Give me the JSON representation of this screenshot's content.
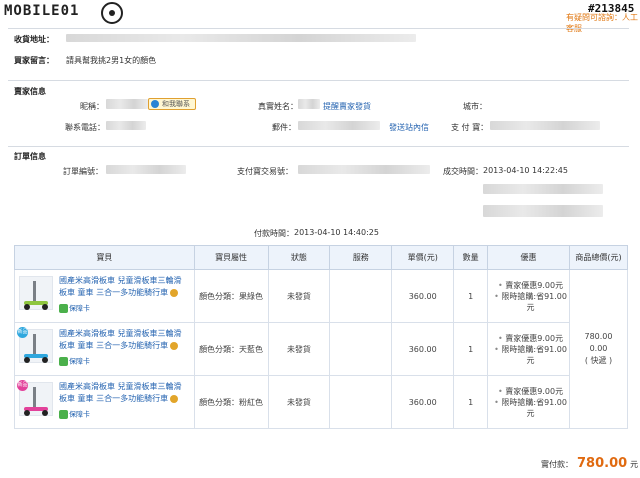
{
  "header": {
    "logo": "MOBILE01",
    "watermark": "#213845",
    "top_link_prefix": "有疑問可諮詢：",
    "top_link_text": "人工客服"
  },
  "shipping": {
    "address_label": "收貨地址：",
    "message_label": "買家留言：",
    "message_value": "請具幫我挑2男1女的顏色"
  },
  "seller": {
    "heading": "賣家信息",
    "nickname_label": "昵稱：",
    "contact_tag": "和我聯系",
    "realname_label": "真實姓名：",
    "realname_link": "提醒賣家發貨",
    "city_label": "城市：",
    "phone_label": "聯系電話：",
    "email_label": "郵件：",
    "send_msg_link": "發送站內信",
    "alipay_label": "支 付 寶："
  },
  "order": {
    "heading": "訂單信息",
    "order_no_label": "訂單編號：",
    "trade_no_label": "支付寶交易號：",
    "deal_time_label": "成交時間：",
    "deal_time_value": "2013-04-10 14:22:45",
    "pay_time_label": "付款時間：",
    "pay_time_value": "2013-04-10 14:40:25"
  },
  "table": {
    "headers": [
      "寶貝",
      "寶貝屬性",
      "狀態",
      "服務",
      "單價(元)",
      "數量",
      "優惠",
      "商品總價(元)"
    ],
    "rows": [
      {
        "title": "國產米高滑板車 兒童滑板車三輪滑板車 童車 三合一多功能騎行車",
        "guard": "保障卡",
        "attr": "顏色分類：果綠色",
        "status": "未發貨",
        "price": "360.00",
        "qty": "1",
        "promo1": "賣家優惠9.00元",
        "promo2": "限時搶購:省91.00元",
        "color": "#8ec63f",
        "badge": ""
      },
      {
        "title": "國產米高滑板車 兒童滑板車三輪滑板車 童車 三合一多功能騎行車",
        "guard": "保障卡",
        "attr": "顏色分類：天藍色",
        "status": "未發貨",
        "price": "360.00",
        "qty": "1",
        "promo1": "賣家優惠9.00元",
        "promo2": "限時搶購:省91.00元",
        "color": "#2fa7de",
        "badge": "新品"
      },
      {
        "title": "國產米高滑板車 兒童滑板車三輪滑板車 童車 三合一多功能騎行車",
        "guard": "保障卡",
        "attr": "顏色分類：粉紅色",
        "status": "未發貨",
        "price": "360.00",
        "qty": "1",
        "promo1": "賣家優惠9.00元",
        "promo2": "限時搶購:省91.00元",
        "color": "#e2419a",
        "badge": "新品"
      }
    ],
    "goods_total": "780.00",
    "shipping_fee": "0.00",
    "shipping_method": "( 快遞 )"
  },
  "footer": {
    "paid_label": "實付款：",
    "paid_amount": "780.00",
    "paid_unit": "元"
  }
}
